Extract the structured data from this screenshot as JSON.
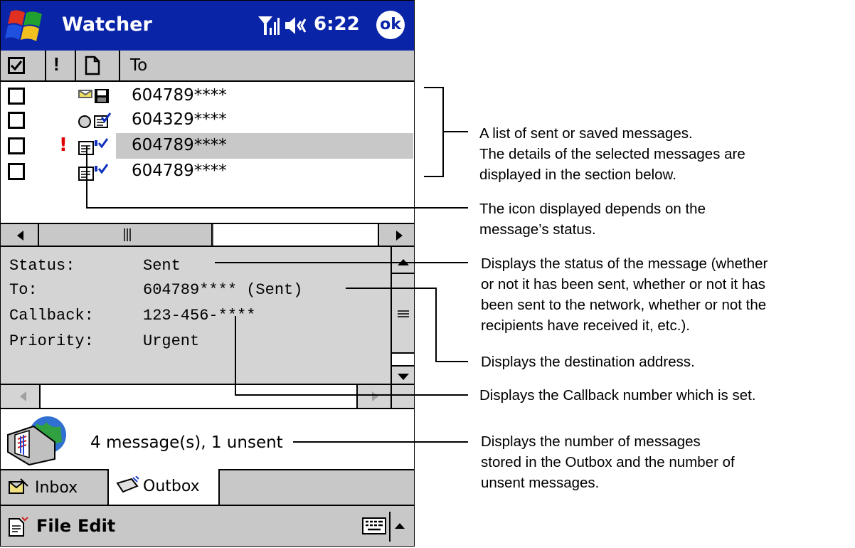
{
  "titlebar": {
    "title": "Watcher",
    "time": "6:22",
    "ok_label": "ok"
  },
  "columns": {
    "to_label": "To"
  },
  "messages": [
    {
      "address": "604789****",
      "urgent": false,
      "icon": "saved-message-icon"
    },
    {
      "address": "604329****",
      "urgent": false,
      "icon": "received-message-icon"
    },
    {
      "address": "604789****",
      "urgent": true,
      "icon": "sent-message-icon",
      "selected": true
    },
    {
      "address": "604789****",
      "urgent": false,
      "icon": "sent-message-icon"
    }
  ],
  "urgent_mark": "!",
  "details": {
    "status_label": "Status:",
    "status_value": "Sent",
    "to_label": "To:",
    "to_value": "604789**** (Sent)",
    "callback_label": "Callback:",
    "callback_value": "123-456-****",
    "priority_label": "Priority:",
    "priority_value": "Urgent"
  },
  "status_text": "4 message(s), 1 unsent",
  "tabs": {
    "inbox": "Inbox",
    "outbox": "Outbox"
  },
  "menu": {
    "file": "File",
    "edit": "Edit"
  },
  "annotations": {
    "list": [
      "A list of sent or saved messages.",
      "The details of the selected messages are",
      "displayed in the section below."
    ],
    "icon": [
      "The icon displayed depends on the",
      "message’s status."
    ],
    "status": [
      "Displays the status of the message (whether",
      "or not it has been sent, whether or not it has",
      "been sent to the network, whether or not the",
      "recipients have received it, etc.)."
    ],
    "destination": [
      "Displays the destination address."
    ],
    "callback": [
      "Displays the Callback number which is set."
    ],
    "count": [
      "Displays the number of messages",
      "stored in the Outbox and the number of",
      "unsent messages."
    ]
  },
  "colors": {
    "titlebar": "#0a24a8",
    "selected_row": "#c8c8c8",
    "urgent": "#e00000"
  }
}
